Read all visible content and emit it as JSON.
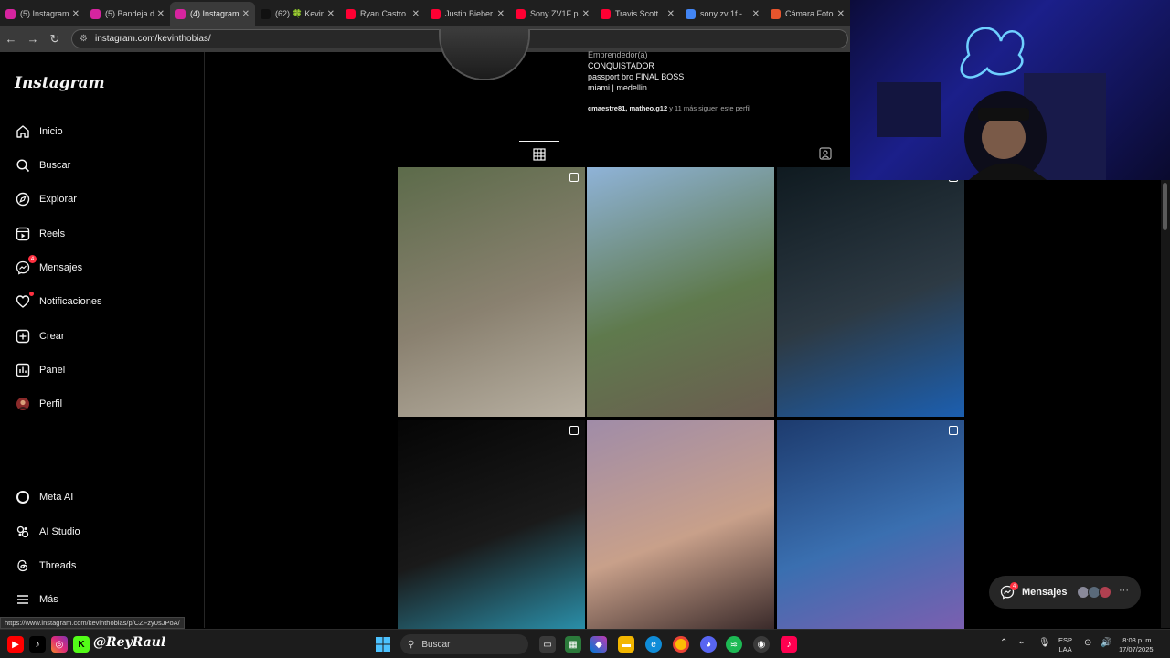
{
  "browser": {
    "tabs": [
      {
        "label": "(5) Instagram",
        "favicon_color": "#d6249f",
        "active": false
      },
      {
        "label": "(5) Bandeja de",
        "favicon_color": "#d6249f",
        "active": false
      },
      {
        "label": "(4) Instagram",
        "favicon_color": "#d6249f",
        "active": true
      },
      {
        "label": "(62) 🍀 Kevin",
        "favicon_color": "#111111",
        "active": false
      },
      {
        "label": "Ryan Castro",
        "favicon_color": "#ff0033",
        "active": false
      },
      {
        "label": "Justin Bieber",
        "favicon_color": "#ff0033",
        "active": false
      },
      {
        "label": "Sony ZV1F p",
        "favicon_color": "#ff0033",
        "active": false
      },
      {
        "label": "Travis Scott",
        "favicon_color": "#ff0033",
        "active": false
      },
      {
        "label": "sony zv 1f -",
        "favicon_color": "#4285f4",
        "active": false
      },
      {
        "label": "Cámara Foto",
        "favicon_color": "#e8552d",
        "active": false
      }
    ],
    "url": "instagram.com/kevinthobias/"
  },
  "sidebar": {
    "logo": "Instagram",
    "items": [
      {
        "label": "Inicio",
        "icon": "home-icon"
      },
      {
        "label": "Buscar",
        "icon": "search-icon"
      },
      {
        "label": "Explorar",
        "icon": "compass-icon"
      },
      {
        "label": "Reels",
        "icon": "reels-icon"
      },
      {
        "label": "Mensajes",
        "icon": "messenger-icon",
        "badge": "4"
      },
      {
        "label": "Notificaciones",
        "icon": "heart-icon",
        "dot": true
      },
      {
        "label": "Crear",
        "icon": "plus-square-icon"
      },
      {
        "label": "Panel",
        "icon": "chart-icon"
      },
      {
        "label": "Perfil",
        "icon": "avatar-icon"
      }
    ],
    "bottom_items": [
      {
        "label": "Meta AI",
        "icon": "meta-ai-icon"
      },
      {
        "label": "AI Studio",
        "icon": "ai-studio-icon"
      },
      {
        "label": "Threads",
        "icon": "threads-icon"
      },
      {
        "label": "Más",
        "icon": "menu-icon"
      }
    ]
  },
  "profile": {
    "category": "Emprendedor(a)",
    "bio_lines": [
      "CONQUISTADOR",
      "passport bro FINAL BOSS",
      "miami | medellin"
    ],
    "followed_by_names": "cmaestre81, matheo.g12",
    "followed_by_rest": " y 11 más siguen este perfil"
  },
  "posts": [
    {
      "name": "post-cars-driveway",
      "multi": true,
      "colors": [
        "#5c6b4a",
        "#8a8170",
        "#b8b0a2"
      ]
    },
    {
      "name": "post-two-men-sofa",
      "multi": false,
      "colors": [
        "#8fb3d8",
        "#5f7a4d",
        "#6b5c50"
      ]
    },
    {
      "name": "post-bugatti-night",
      "multi": true,
      "colors": [
        "#0f1a20",
        "#2d3a44",
        "#1c5fb0"
      ]
    },
    {
      "name": "post-party-car",
      "multi": true,
      "colors": [
        "#050505",
        "#1a1a1a",
        "#2a8ea8"
      ]
    },
    {
      "name": "post-group-photo",
      "multi": false,
      "colors": [
        "#a08ca8",
        "#c8a08a",
        "#3a2a2a"
      ]
    },
    {
      "name": "post-studio-award",
      "multi": true,
      "colors": [
        "#1d3b6e",
        "#3a6fb0",
        "#7b5fb0"
      ]
    }
  ],
  "messages_pill": {
    "label": "Mensajes",
    "badge": "4"
  },
  "status_url": "https://www.instagram.com/kevinthobias/p/CZFzy0sJPoA/",
  "taskbar": {
    "handle": "@ReyRaul",
    "search_label": "Buscar",
    "lang": "ESP",
    "lang_sub": "LAA",
    "time": "8:08 p. m.",
    "date": "17/07/2025"
  }
}
